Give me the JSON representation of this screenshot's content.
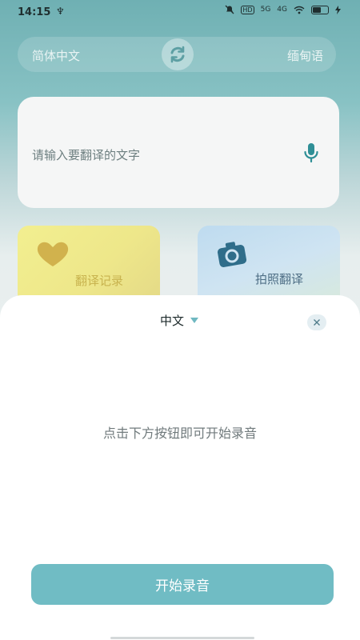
{
  "status_bar": {
    "time": "14:15",
    "usb": "♆",
    "icons": [
      "bell-off-icon",
      "hd-icon",
      "5g-icon",
      "4g-icon",
      "wifi-icon",
      "battery-icon",
      "charging-icon"
    ],
    "hd_label": "HD",
    "net1_label": "5G",
    "net2_label": "4G"
  },
  "lang_bar": {
    "source": "简体中文",
    "target": "缅甸语"
  },
  "input": {
    "placeholder": "请输入要翻译的文字"
  },
  "tiles": {
    "records_label": "翻译记录",
    "photo_label": "拍照翻译"
  },
  "sheet": {
    "language": "中文",
    "hint": "点击下方按钮即可开始录音",
    "start_button": "开始录音"
  },
  "colors": {
    "accent": "#70bcc4",
    "arrow": "#6fb8c1",
    "header_gradient_top": "#6fb0b3"
  }
}
